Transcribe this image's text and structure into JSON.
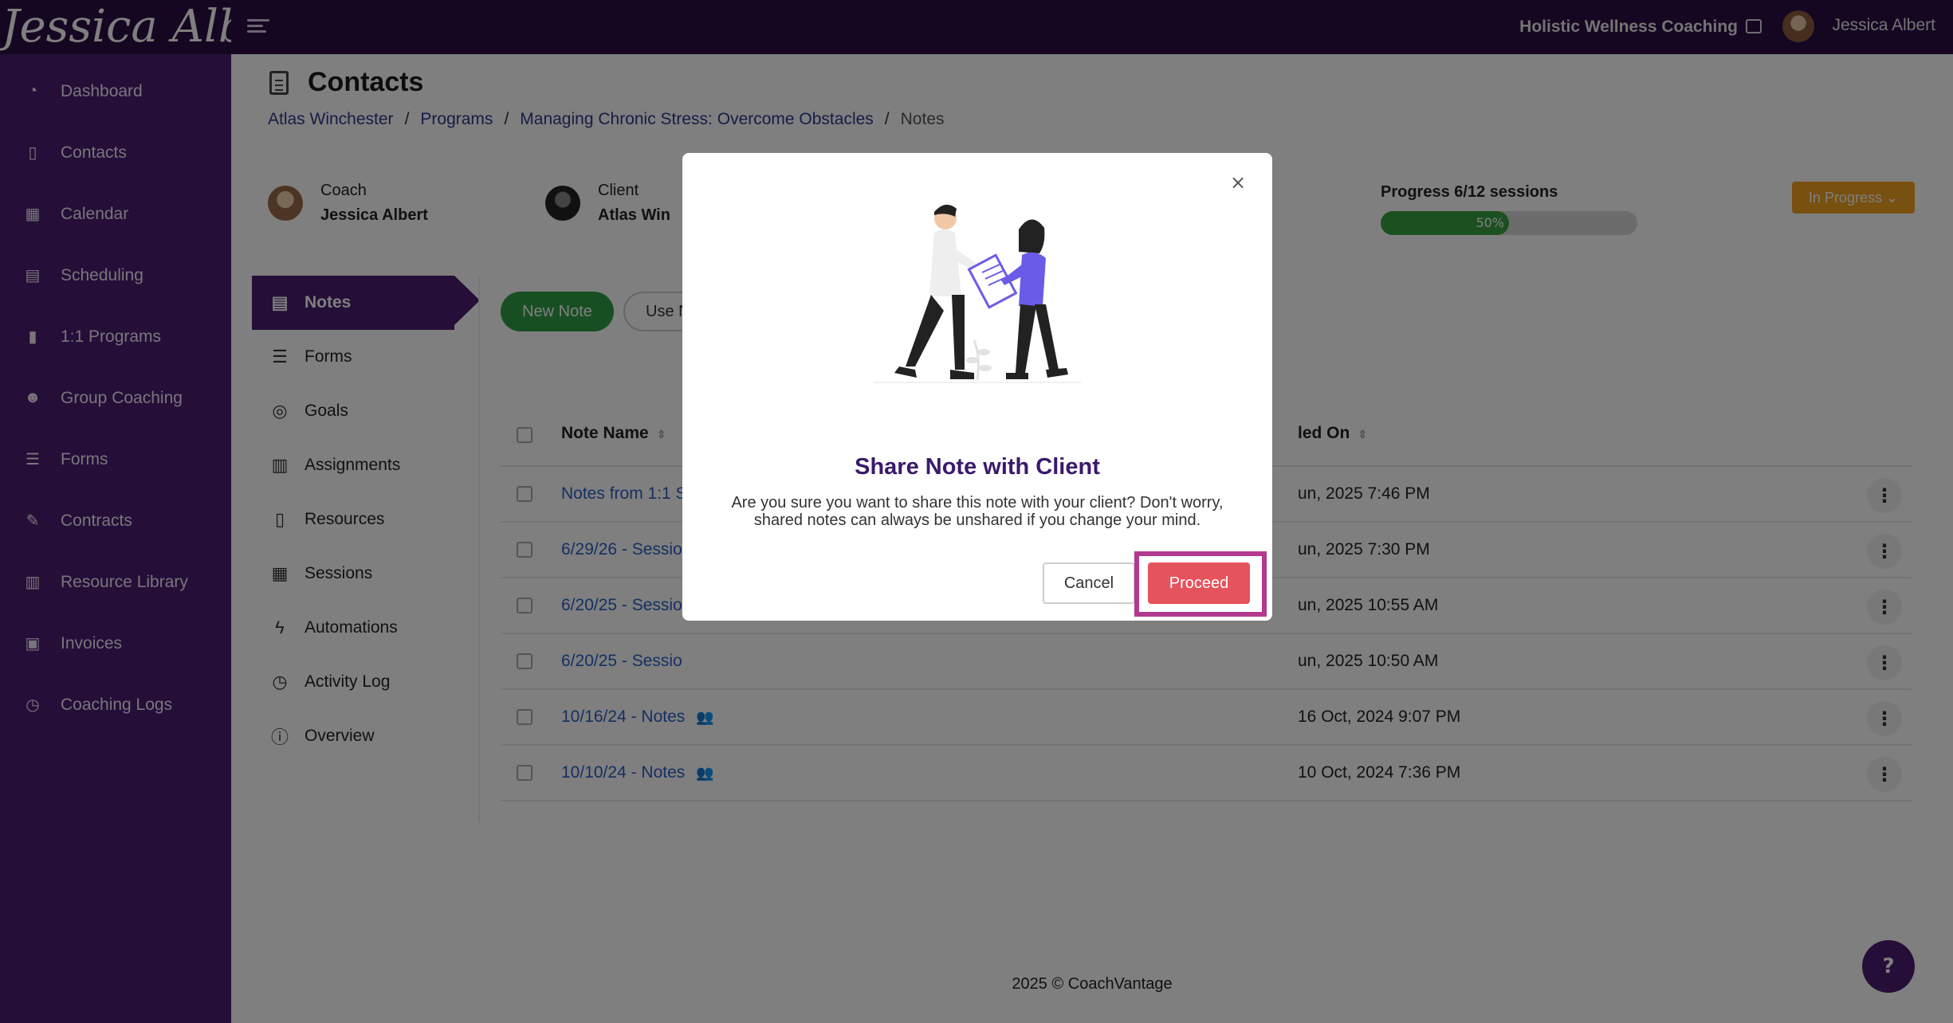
{
  "header": {
    "logo_text": "Jessica Albert",
    "org_name": "Holistic Wellness Coaching",
    "user_name": "Jessica Albert"
  },
  "sidebar": {
    "items": [
      {
        "label": "Dashboard",
        "icon": "dashboard-icon"
      },
      {
        "label": "Contacts",
        "icon": "contacts-icon"
      },
      {
        "label": "Calendar",
        "icon": "calendar-icon"
      },
      {
        "label": "Scheduling",
        "icon": "scheduling-icon"
      },
      {
        "label": "1:1 Programs",
        "icon": "book-icon"
      },
      {
        "label": "Group Coaching",
        "icon": "group-icon"
      },
      {
        "label": "Forms",
        "icon": "forms-icon"
      },
      {
        "label": "Contracts",
        "icon": "contract-icon"
      },
      {
        "label": "Resource Library",
        "icon": "library-icon"
      },
      {
        "label": "Invoices",
        "icon": "invoice-icon"
      },
      {
        "label": "Coaching Logs",
        "icon": "clock-icon"
      }
    ]
  },
  "page": {
    "title": "Contacts",
    "breadcrumb": [
      "Atlas Winchester",
      "Programs",
      "Managing Chronic Stress: Overcome Obstacles",
      "Notes"
    ],
    "breadcrumb_sep": "/"
  },
  "program": {
    "coach_label": "Coach",
    "coach_name": "Jessica Albert",
    "client_label": "Client",
    "client_name": "Atlas Win",
    "progress_label": "Progress 6/12 sessions",
    "progress_percent": 50,
    "progress_text": "50%",
    "status": "In Progress",
    "status_color": "#f0a020"
  },
  "subnav": {
    "items": [
      {
        "label": "Notes",
        "icon": "notes-icon",
        "active": true
      },
      {
        "label": "Forms",
        "icon": "forms-list-icon"
      },
      {
        "label": "Goals",
        "icon": "target-icon"
      },
      {
        "label": "Assignments",
        "icon": "clipboard-icon"
      },
      {
        "label": "Resources",
        "icon": "book-icon"
      },
      {
        "label": "Sessions",
        "icon": "calendar-icon"
      },
      {
        "label": "Automations",
        "icon": "bolt-icon"
      },
      {
        "label": "Activity Log",
        "icon": "history-icon"
      },
      {
        "label": "Overview",
        "icon": "info-icon"
      }
    ]
  },
  "toolbar": {
    "new_note_label": "New Note",
    "use_label": "Use N"
  },
  "table": {
    "col_name": "Note Name",
    "col_date": "led On",
    "rows": [
      {
        "name": "Notes from 1:1 S",
        "date": "un, 2025 7:46 PM",
        "shared": false
      },
      {
        "name": "6/29/26 - Sessio",
        "date": "un, 2025 7:30 PM",
        "shared": false
      },
      {
        "name": "6/20/25 - Sessio",
        "date": "un, 2025 10:55 AM",
        "shared": false
      },
      {
        "name": "6/20/25 - Sessio",
        "date": "un, 2025 10:50 AM",
        "shared": false
      },
      {
        "name": "10/16/24 - Notes",
        "date": "16 Oct, 2024 9:07 PM",
        "shared": true
      },
      {
        "name": "10/10/24 - Notes",
        "date": "10 Oct, 2024 7:36 PM",
        "shared": true
      }
    ]
  },
  "footer": {
    "text": "2025 © CoachVantage",
    "help_label": "?"
  },
  "modal": {
    "title": "Share Note with Client",
    "message": "Are you sure you want to share this note with your client? Don't worry, shared notes can always be unshared if you change your mind.",
    "cancel_label": "Cancel",
    "proceed_label": "Proceed",
    "close_label": "×"
  },
  "colors": {
    "sidebar_bg": "#4a1c70",
    "topbar_bg": "#2a0f45",
    "proceed": "#e5535d",
    "highlight": "#b23a8e"
  }
}
